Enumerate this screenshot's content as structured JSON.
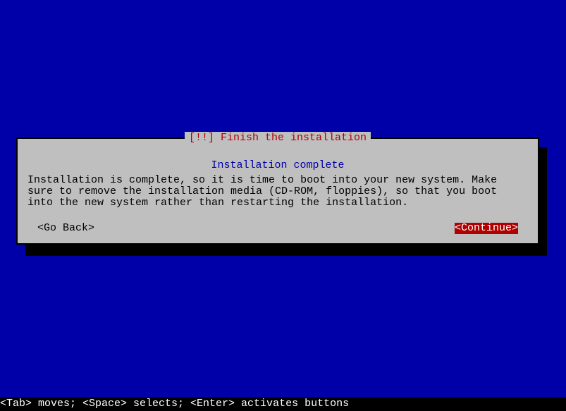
{
  "dialog": {
    "title": "[!!] Finish the installation",
    "subtitle": "Installation complete",
    "body": "Installation is complete, so it is time to boot into your new system. Make sure to remove the installation media (CD-ROM, floppies), so that you boot into the new system rather than restarting the installation.",
    "back_label": "<Go Back>",
    "continue_label": "<Continue>"
  },
  "help_bar": "<Tab> moves; <Space> selects; <Enter> activates buttons"
}
